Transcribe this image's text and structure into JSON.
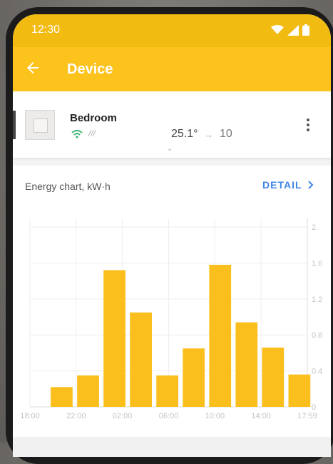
{
  "status_bar": {
    "time": "12:30"
  },
  "app_bar": {
    "title": "Device"
  },
  "device": {
    "name": "Bedroom",
    "heating_mode": "///",
    "current_temp": "25.1°",
    "target_arrow": "→",
    "target_temp": "10",
    "expand_glyph": "⌄"
  },
  "chart_card": {
    "label": "Energy chart, kW·h",
    "detail_label": "DETAIL"
  },
  "colors": {
    "bar": "#fbbf1d",
    "accent_blue": "#3f86e6",
    "app_bar": "#fbc31c"
  },
  "chart_data": {
    "type": "bar",
    "title": "",
    "xlabel": "",
    "ylabel": "",
    "x_ticks": [
      "18:00",
      "22:00",
      "02:00",
      "06:00",
      "10:00",
      "14:00",
      "17:59"
    ],
    "y_ticks": [
      "0",
      "0.4",
      "0.8",
      "1.2",
      "1.6",
      "2"
    ],
    "ylim": [
      0,
      2
    ],
    "values": [
      0.22,
      0.35,
      1.52,
      1.05,
      0.35,
      0.65,
      1.58,
      0.94,
      0.66,
      0.36
    ],
    "grid": true
  }
}
